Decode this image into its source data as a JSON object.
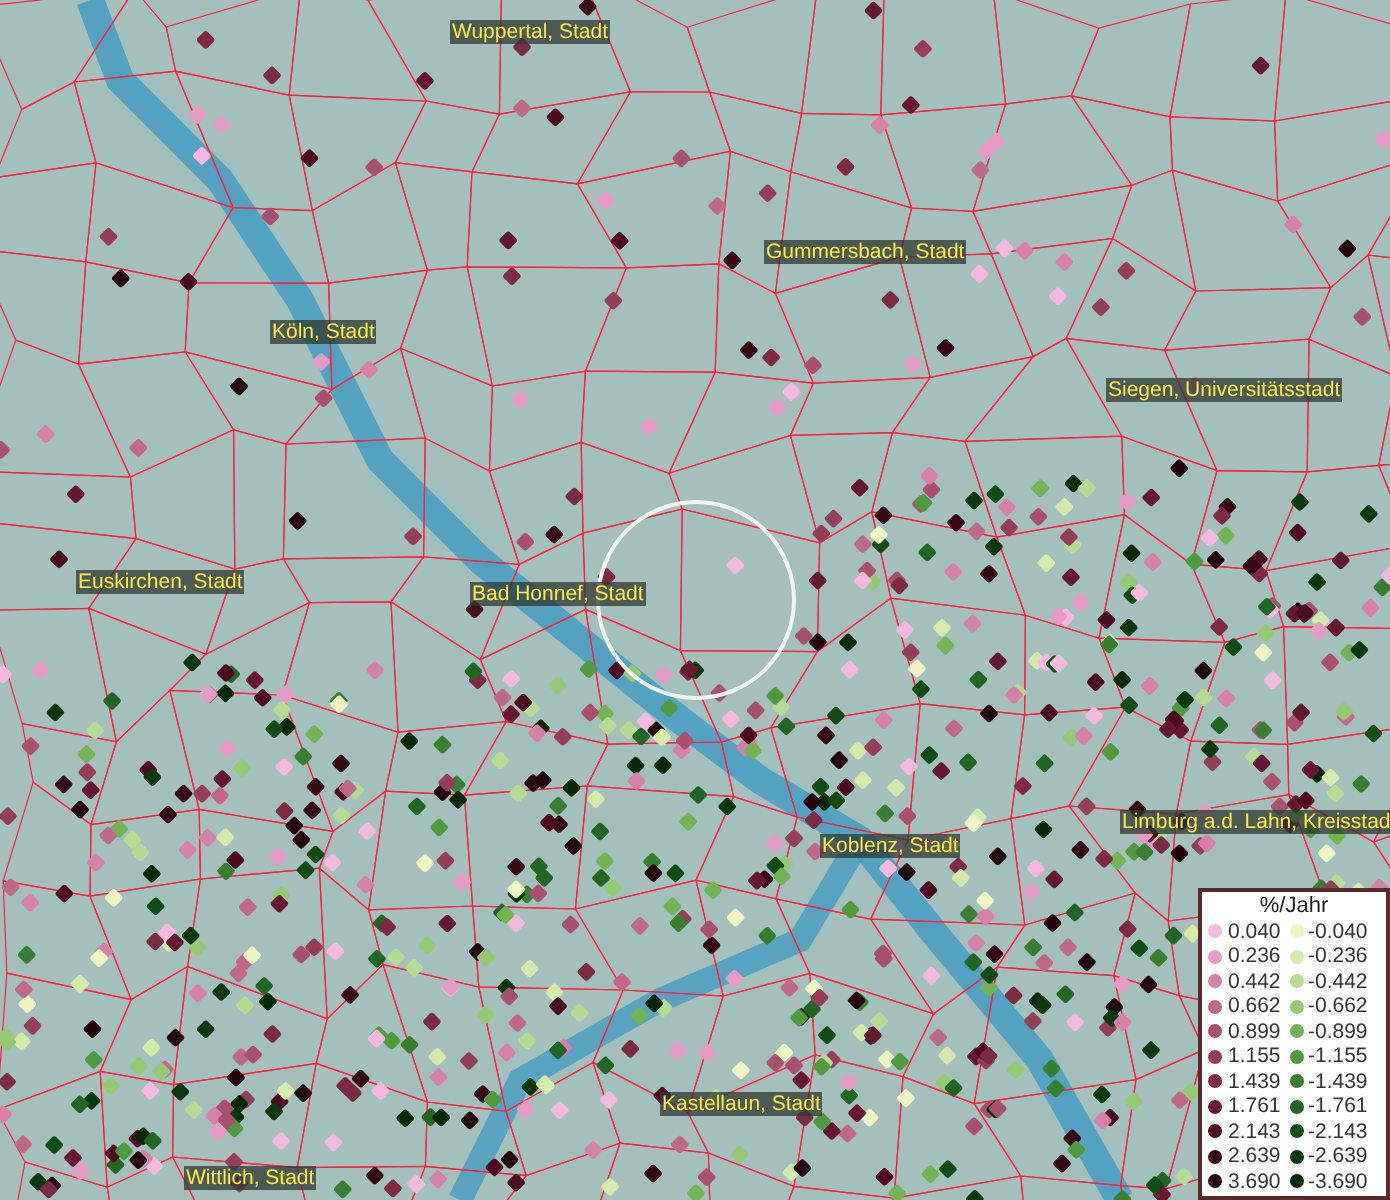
{
  "map": {
    "places": [
      {
        "name": "Wuppertal, Stadt"
      },
      {
        "name": "Gummersbach, Stadt"
      },
      {
        "name": "Köln, Stadt"
      },
      {
        "name": "Siegen, Universitätsstadt"
      },
      {
        "name": "Euskirchen, Stadt"
      },
      {
        "name": "Bad Honnef, Stadt"
      },
      {
        "name": "Limburg a.d. Lahn, Kreisstad"
      },
      {
        "name": "Koblenz, Stadt"
      },
      {
        "name": "Kastellaun, Stadt"
      },
      {
        "name": "Wittlich, Stadt"
      }
    ]
  },
  "legend": {
    "title": "%/Jahr",
    "rows": [
      {
        "positive": {
          "value": "0.040",
          "color": "#f5b8e0"
        },
        "negative": {
          "value": "-0.040",
          "color": "#eef5c0"
        }
      },
      {
        "positive": {
          "value": "0.236",
          "color": "#e79ac8"
        },
        "negative": {
          "value": "-0.236",
          "color": "#d4ebaa"
        }
      },
      {
        "positive": {
          "value": "0.442",
          "color": "#d67fa8"
        },
        "negative": {
          "value": "-0.442",
          "color": "#b5dd92"
        }
      },
      {
        "positive": {
          "value": "0.662",
          "color": "#c06888"
        },
        "negative": {
          "value": "-0.662",
          "color": "#94cb72"
        }
      },
      {
        "positive": {
          "value": "0.899",
          "color": "#a8506e"
        },
        "negative": {
          "value": "-0.899",
          "color": "#72b454"
        }
      },
      {
        "positive": {
          "value": "1.155",
          "color": "#963e58"
        },
        "negative": {
          "value": "-1.155",
          "color": "#4f9a3c"
        }
      },
      {
        "positive": {
          "value": "1.439",
          "color": "#7e2a42"
        },
        "negative": {
          "value": "-1.439",
          "color": "#388030"
        }
      },
      {
        "positive": {
          "value": "1.761",
          "color": "#661830"
        },
        "negative": {
          "value": "-1.761",
          "color": "#226624"
        }
      },
      {
        "positive": {
          "value": "2.143",
          "color": "#4c0c1e"
        },
        "negative": {
          "value": "-2.143",
          "color": "#104c14"
        }
      },
      {
        "positive": {
          "value": "2.639",
          "color": "#360812"
        },
        "negative": {
          "value": "-2.639",
          "color": "#08380c"
        }
      },
      {
        "positive": {
          "value": "3.690",
          "color": "#22040a"
        },
        "negative": {
          "value": "-3.690",
          "color": "#042806"
        }
      }
    ]
  }
}
